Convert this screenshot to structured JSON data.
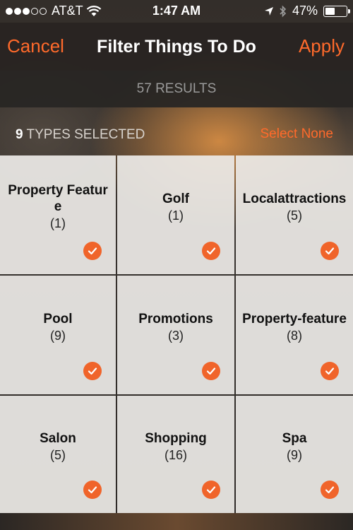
{
  "status_bar": {
    "carrier": "AT&T",
    "time": "1:47 AM",
    "battery_percent": "47%",
    "battery_level": 0.47,
    "signal_bars": 3,
    "signal_total": 5
  },
  "nav": {
    "cancel_label": "Cancel",
    "title": "Filter Things To Do",
    "apply_label": "Apply"
  },
  "results": {
    "label": "57 RESULTS"
  },
  "types": {
    "count": "9",
    "label": "TYPES SELECTED",
    "select_none_label": "Select None"
  },
  "tiles": [
    {
      "name": "Property Feature",
      "count": "(1)",
      "selected": true
    },
    {
      "name": "Golf",
      "count": "(1)",
      "selected": true
    },
    {
      "name": "Localattractions",
      "count": "(5)",
      "selected": true
    },
    {
      "name": "Pool",
      "count": "(9)",
      "selected": true
    },
    {
      "name": "Promotions",
      "count": "(3)",
      "selected": true
    },
    {
      "name": "Property-feature",
      "count": "(8)",
      "selected": true
    },
    {
      "name": "Salon",
      "count": "(5)",
      "selected": true
    },
    {
      "name": "Shopping",
      "count": "(16)",
      "selected": true
    },
    {
      "name": "Spa",
      "count": "(9)",
      "selected": true
    }
  ],
  "colors": {
    "accent": "#ff6a2b",
    "check": "#f0642a",
    "tile_bg": "#ecebe6"
  }
}
